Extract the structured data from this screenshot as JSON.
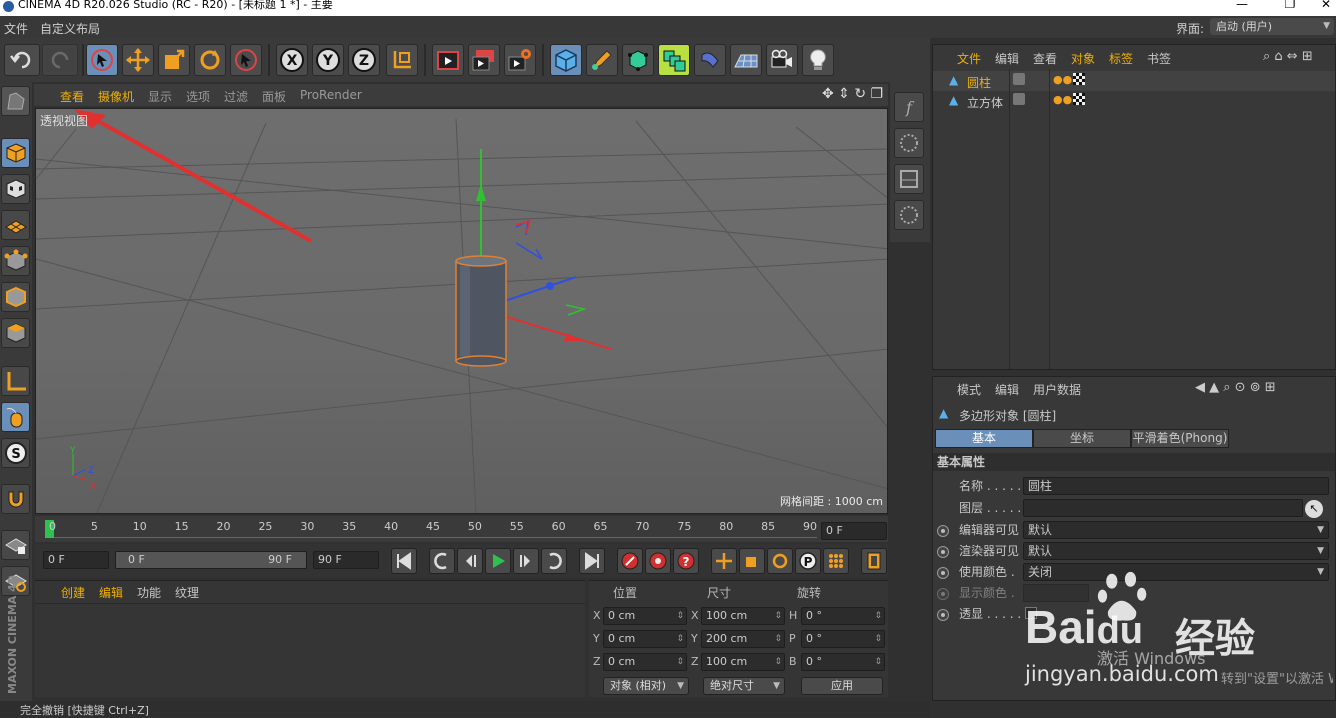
{
  "window": {
    "title": "CINEMA 4D R20.026 Studio (RC - R20) - [未标题 1 *] - 主要",
    "minimize": "—",
    "restore": "❐",
    "close": "✕"
  },
  "menubar": {
    "items": [
      "文件",
      "自定义布局"
    ],
    "layout_label": "界面:",
    "layout_value": "启动 (用户)"
  },
  "viewport": {
    "menu": [
      "查看",
      "摄像机",
      "显示",
      "选项",
      "过滤",
      "面板",
      "ProRender"
    ],
    "label": "透视视图",
    "grid_label": "网格间距 : 1000 cm",
    "colors": {
      "x_axis": "#e03030",
      "y_axis": "#30c030",
      "z_axis": "#3050e0",
      "selection": "#e08030"
    }
  },
  "timeline": {
    "ticks": [
      "0",
      "5",
      "10",
      "15",
      "20",
      "25",
      "30",
      "35",
      "40",
      "45",
      "50",
      "55",
      "60",
      "65",
      "70",
      "75",
      "80",
      "85",
      "90"
    ],
    "current_frame": "0 F"
  },
  "playbar": {
    "start": "0 F",
    "range_start": "0 F",
    "range_end": "90 F",
    "end": "90 F"
  },
  "material_panel": {
    "menu": [
      "创建",
      "编辑",
      "功能",
      "纹理"
    ]
  },
  "coord_panel": {
    "headers": [
      "位置",
      "尺寸",
      "旋转"
    ],
    "rows": [
      {
        "axis": "X",
        "pos": "0 cm",
        "size_axis": "X",
        "size": "100 cm",
        "rot_axis": "H",
        "rot": "0 °"
      },
      {
        "axis": "Y",
        "pos": "0 cm",
        "size_axis": "Y",
        "size": "200 cm",
        "rot_axis": "P",
        "rot": "0 °"
      },
      {
        "axis": "Z",
        "pos": "0 cm",
        "size_axis": "Z",
        "size": "100 cm",
        "rot_axis": "B",
        "rot": "0 °"
      }
    ],
    "mode": "对象 (相对)",
    "size_mode": "绝对尺寸",
    "apply": "应用"
  },
  "status": "完全撤销 [快捷键 Ctrl+Z]",
  "object_manager": {
    "menu": [
      "文件",
      "编辑",
      "查看",
      "对象",
      "标签",
      "书签"
    ],
    "objects": [
      {
        "name": "圆柱"
      },
      {
        "name": "立方体"
      }
    ]
  },
  "attribute_manager": {
    "menu": [
      "模式",
      "编辑",
      "用户数据"
    ],
    "object_title": "多边形对象 [圆柱]",
    "tabs": [
      "基本",
      "坐标",
      "平滑着色(Phong)"
    ],
    "section": "基本属性",
    "fields": [
      {
        "label": "名称",
        "dots": " . . . . .",
        "value": "圆柱"
      },
      {
        "label": "图层",
        "dots": " . . . . .",
        "value": ""
      },
      {
        "label": "编辑器可见",
        "dots": "",
        "value": "默认"
      },
      {
        "label": "渲染器可见",
        "dots": "",
        "value": "默认"
      },
      {
        "label": "使用颜色",
        "dots": " . ",
        "value": "关闭"
      },
      {
        "label": "显示颜色",
        "dots": " . ",
        "value": ""
      },
      {
        "label": "透显",
        "dots": " . . . . .",
        "value": ""
      }
    ]
  },
  "watermark": {
    "brand": "Bai",
    "brand2": "du",
    "brand_cn": "经验",
    "site": "jingyan.baidu.com",
    "activate": "激活 Windows",
    "activate_sub": "转到\"设置\"以激活 Windows。"
  },
  "side_brand": "MAXON CINEMA 4D"
}
